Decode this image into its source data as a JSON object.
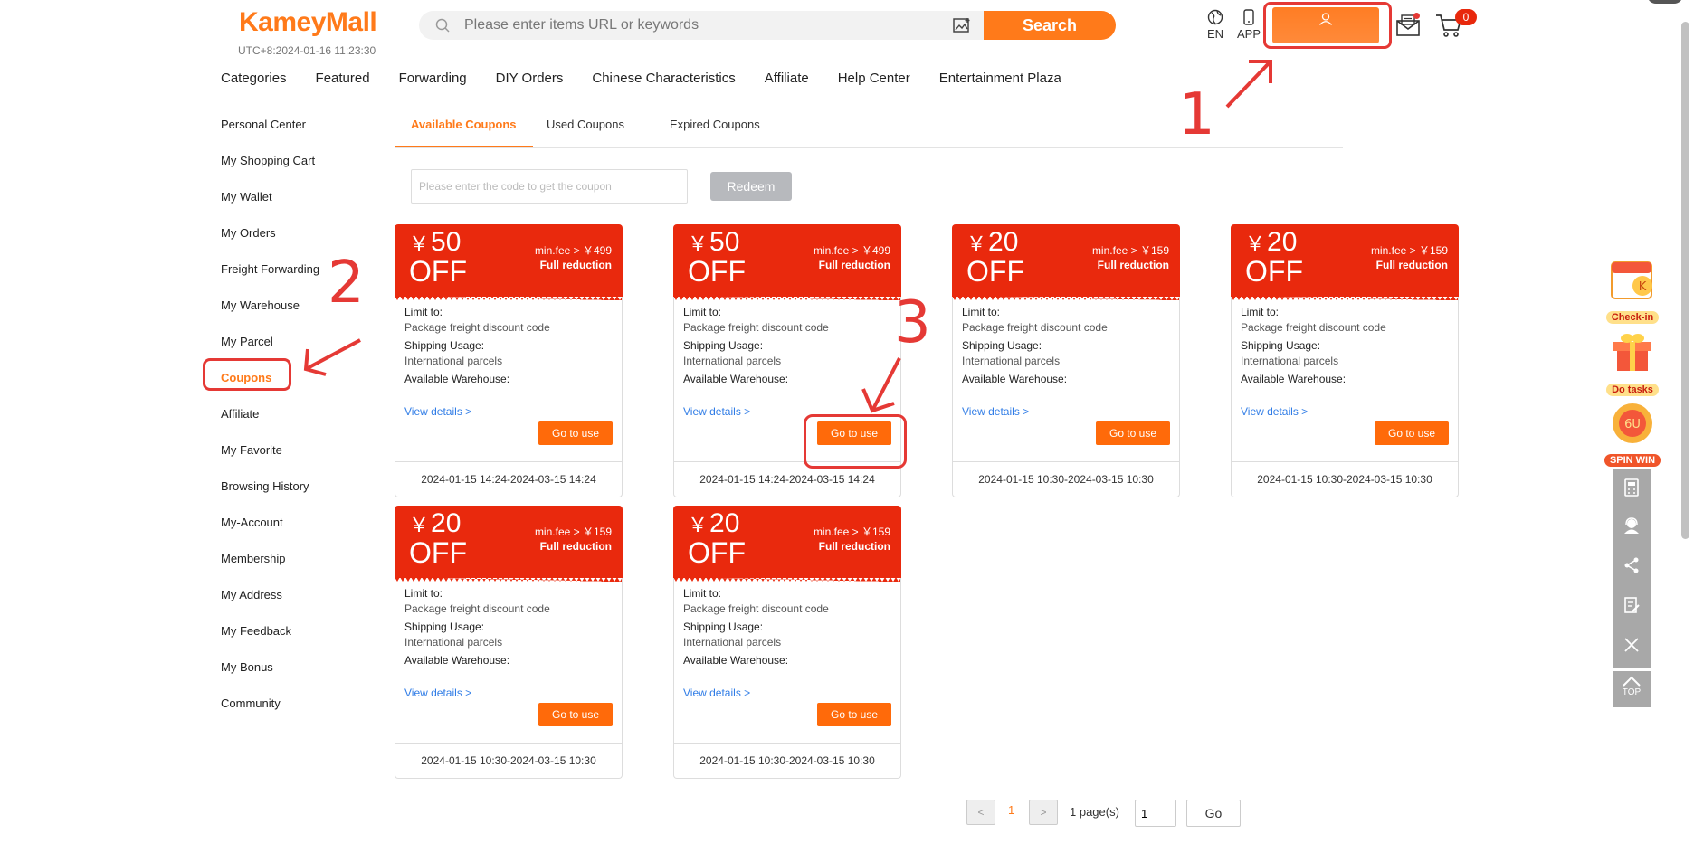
{
  "header": {
    "logo": "KameyMall",
    "clock": "UTC+8:2024-01-16 11:23:30",
    "search_placeholder": "Please enter items URL or keywords",
    "search_button": "Search",
    "lang": "EN",
    "app": "APP",
    "cart_count": "0"
  },
  "nav": [
    "Categories",
    "Featured",
    "Forwarding",
    "DIY Orders",
    "Chinese Characteristics",
    "Affiliate",
    "Help Center",
    "Entertainment Plaza"
  ],
  "sidebar": [
    "Personal Center",
    "My Shopping Cart",
    "My Wallet",
    "My Orders",
    "Freight Forwarding",
    "My Warehouse",
    "My Parcel",
    "Coupons",
    "Affiliate",
    "My Favorite",
    "Browsing History",
    "My-Account",
    "Membership",
    "My Address",
    "My Feedback",
    "My Bonus",
    "Community"
  ],
  "tabs": [
    "Available Coupons",
    "Used Coupons",
    "Expired Coupons"
  ],
  "redeem": {
    "placeholder": "Please enter the code to get the coupon",
    "button": "Redeem"
  },
  "coupon_labels": {
    "off": "OFF",
    "full_reduction": "Full reduction",
    "limit_to": "Limit to:",
    "limit_value": "Package freight discount code",
    "shipping_usage": "Shipping Usage:",
    "shipping_value": "International parcels",
    "warehouse": "Available Warehouse:",
    "view_details": "View details >",
    "go_to_use": "Go to use"
  },
  "coupons": [
    {
      "amount": "50",
      "min_fee": "min.fee > ￥499",
      "dates": "2024-01-15 14:24-2024-03-15 14:24"
    },
    {
      "amount": "50",
      "min_fee": "min.fee > ￥499",
      "dates": "2024-01-15 14:24-2024-03-15 14:24"
    },
    {
      "amount": "20",
      "min_fee": "min.fee > ￥159",
      "dates": "2024-01-15 10:30-2024-03-15 10:30"
    },
    {
      "amount": "20",
      "min_fee": "min.fee > ￥159",
      "dates": "2024-01-15 10:30-2024-03-15 10:30"
    },
    {
      "amount": "20",
      "min_fee": "min.fee > ￥159",
      "dates": "2024-01-15 10:30-2024-03-15 10:30"
    },
    {
      "amount": "20",
      "min_fee": "min.fee > ￥159",
      "dates": "2024-01-15 10:30-2024-03-15 10:30"
    }
  ],
  "currency_symbol": "￥",
  "pagination": {
    "prev": "<",
    "current": "1",
    "next": ">",
    "info": "1 page(s)",
    "input_value": "1",
    "go": "Go"
  },
  "widgets": {
    "checkin": "Check-in",
    "tasks": "Do tasks",
    "spin": "SPIN WIN",
    "top": "TOP"
  },
  "annotations": [
    "1",
    "2",
    "3"
  ],
  "colors": {
    "brand": "#ff7a1a",
    "coupon_red": "#e9290d",
    "annotation": "#e53935",
    "link": "#2f7ce6"
  }
}
